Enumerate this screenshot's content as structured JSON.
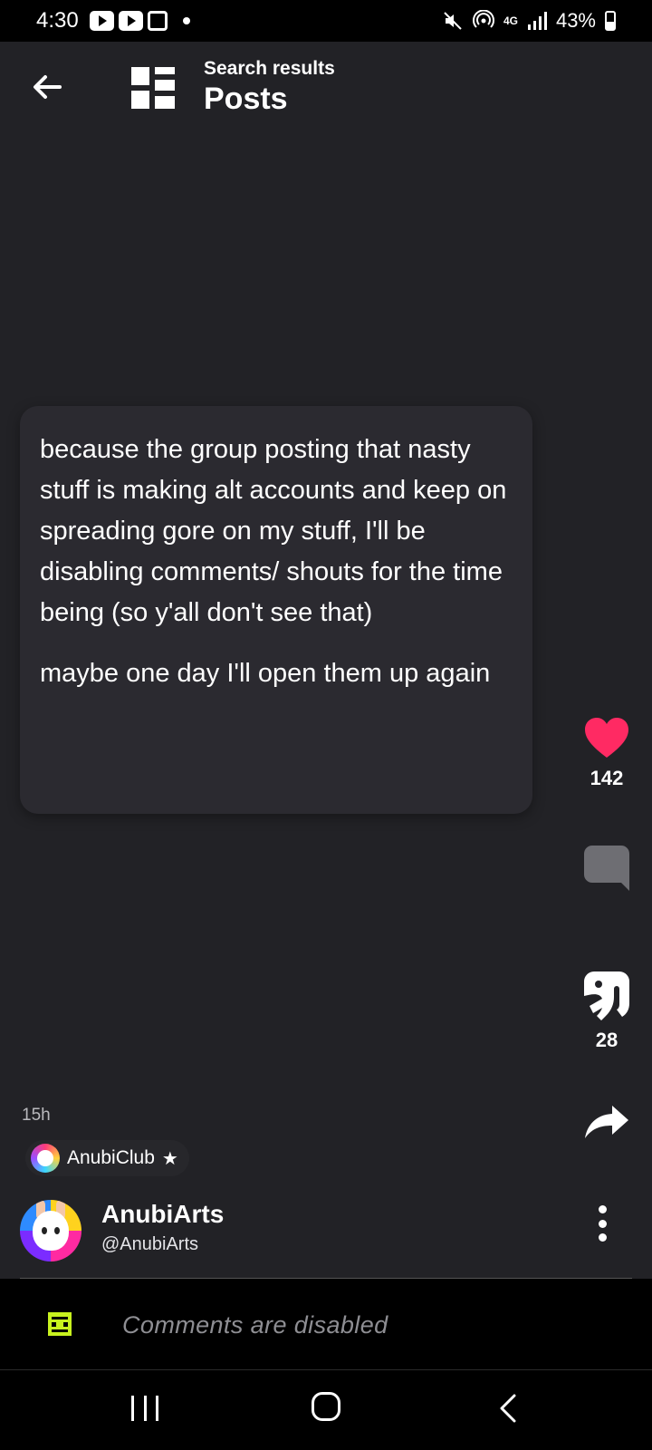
{
  "status_bar": {
    "time": "4:30",
    "network": "4G",
    "battery": "43%",
    "icons": [
      "youtube-icon",
      "youtube-icon",
      "gallery-icon",
      "dot-icon",
      "mute-icon",
      "hotspot-icon",
      "signal-icon",
      "battery-icon"
    ]
  },
  "header": {
    "subtitle": "Search results",
    "title": "Posts",
    "back_icon": "arrow-left-icon",
    "logo_icon": "app-logo-icon"
  },
  "post": {
    "paragraphs": [
      "because the group posting that nasty stuff is making alt accounts and keep on spreading gore on my stuff, I'll be disabling comments/ shouts for the time being (so y'all don't see that)",
      "maybe one day I'll open them up again"
    ],
    "age": "15h",
    "community": "AnubiClub",
    "author_name": "AnubiArts",
    "author_handle": "@AnubiArts"
  },
  "actions": {
    "likes": "142",
    "comments": "",
    "reblogs": "28",
    "like_color": "#ff2a63",
    "comment_color": "#6e6e73"
  },
  "comments_bar": {
    "text": "Comments are disabled",
    "icon_color": "#c8f21e"
  }
}
